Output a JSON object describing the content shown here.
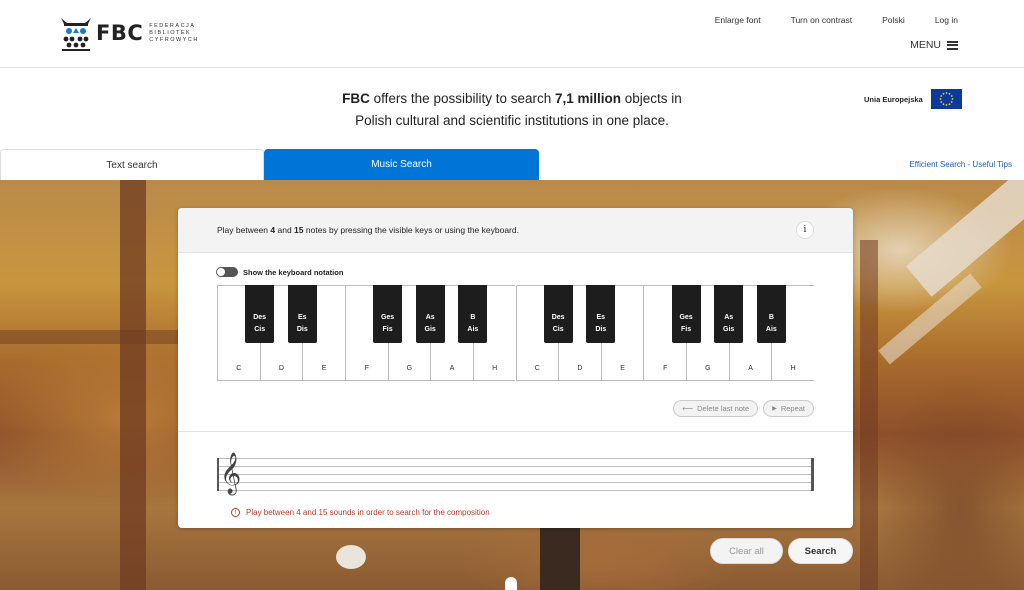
{
  "header": {
    "logo_text": "FBC",
    "logo_sub": [
      "FEDERACJA",
      "BIBLIOTEK",
      "CYFROWYCH"
    ],
    "links": [
      "Enlarge font",
      "Turn on contrast",
      "Polski",
      "Log in"
    ],
    "menu_label": "MENU"
  },
  "tagline": {
    "brand": "FBC",
    "part1": " offers the possibility to search ",
    "count": "7,1 million",
    "part2": " objects in",
    "line2": "Polish cultural and scientific institutions in one place."
  },
  "eu": {
    "label": "Unia Europejska",
    "flag_color": "#0b3a9b"
  },
  "tabs": {
    "text_search": "Text search",
    "music_search": "Music Search",
    "active_color": "#0075d8"
  },
  "tips_link": "Efficient Search - Useful Tips",
  "card": {
    "instr_pre": "Play between ",
    "instr_min": "4",
    "instr_and": " and ",
    "instr_max": "15",
    "instr_post": " notes by pressing the visible keys or using the keyboard.",
    "info_label": "i",
    "toggle_label": "Show the keyboard notation",
    "white_keys": [
      "C",
      "D",
      "E",
      "F",
      "G",
      "A",
      "H",
      "C",
      "D",
      "E",
      "F",
      "G",
      "A",
      "H"
    ],
    "black_keys": [
      {
        "top": "Des",
        "bottom": "Cis"
      },
      {
        "top": "Es",
        "bottom": "Dis"
      },
      {
        "top": "Ges",
        "bottom": "Fis"
      },
      {
        "top": "As",
        "bottom": "Gis"
      },
      {
        "top": "B",
        "bottom": "Ais"
      },
      {
        "top": "Des",
        "bottom": "Cis"
      },
      {
        "top": "Es",
        "bottom": "Dis"
      },
      {
        "top": "Ges",
        "bottom": "Fis"
      },
      {
        "top": "As",
        "bottom": "Gis"
      },
      {
        "top": "B",
        "bottom": "Ais"
      }
    ],
    "delete_label": "Delete last note",
    "repeat_label": "Repeat",
    "clef": "𝄞",
    "warning": "Play between 4 and 15 sounds in order to search for the composition",
    "warning_color": "#c0392b"
  },
  "actions": {
    "clear": "Clear all",
    "search": "Search"
  }
}
